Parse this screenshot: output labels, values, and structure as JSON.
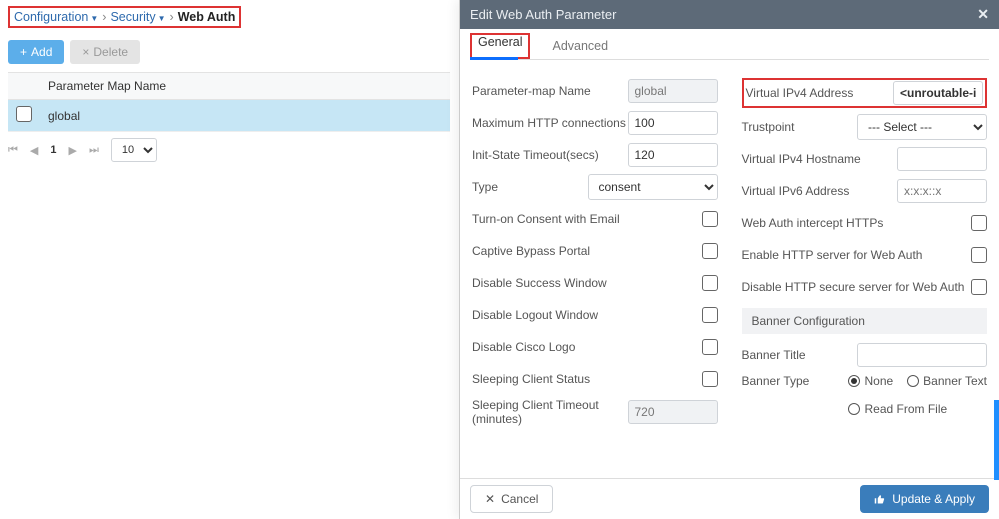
{
  "breadcrumb": {
    "items": [
      "Configuration",
      "Security"
    ],
    "current": "Web Auth"
  },
  "actions": {
    "add": "Add",
    "delete": "Delete"
  },
  "grid": {
    "header": "Parameter Map Name",
    "rows": [
      {
        "name": "global"
      }
    ]
  },
  "pager": {
    "page": "1",
    "size": "10"
  },
  "panel": {
    "title": "Edit Web Auth Parameter",
    "tabs": {
      "general": "General",
      "advanced": "Advanced"
    },
    "general_left": {
      "param_name_label": "Parameter-map Name",
      "param_name_value": "global",
      "max_http_label": "Maximum HTTP connections",
      "max_http_value": "100",
      "init_timeout_label": "Init-State Timeout(secs)",
      "init_timeout_value": "120",
      "type_label": "Type",
      "type_value": "consent",
      "consent_email_label": "Turn-on Consent with Email",
      "captive_bypass_label": "Captive Bypass Portal",
      "disable_success_label": "Disable Success Window",
      "disable_logout_label": "Disable Logout Window",
      "disable_logo_label": "Disable Cisco Logo",
      "sleep_status_label": "Sleeping Client Status",
      "sleep_timeout_label": "Sleeping Client Timeout (minutes)",
      "sleep_timeout_value": "720"
    },
    "general_right": {
      "vip4_label": "Virtual IPv4 Address",
      "vip4_value": "<unroutable-ip>",
      "trustpoint_label": "Trustpoint",
      "trustpoint_value": "--- Select ---",
      "vip4host_label": "Virtual IPv4 Hostname",
      "vip4host_value": "",
      "vip6_label": "Virtual IPv6 Address",
      "vip6_placeholder": "x:x:x::x",
      "intercept_label": "Web Auth intercept HTTPs",
      "enable_http_label": "Enable HTTP server for Web Auth",
      "disable_https_label": "Disable HTTP secure server for Web Auth",
      "banner_section": "Banner Configuration",
      "banner_title_label": "Banner Title",
      "banner_title_value": "",
      "banner_type_label": "Banner Type",
      "banner_types": {
        "none": "None",
        "text": "Banner Text",
        "file": "Read From File"
      }
    },
    "footer": {
      "cancel": "Cancel",
      "apply": "Update & Apply"
    }
  }
}
